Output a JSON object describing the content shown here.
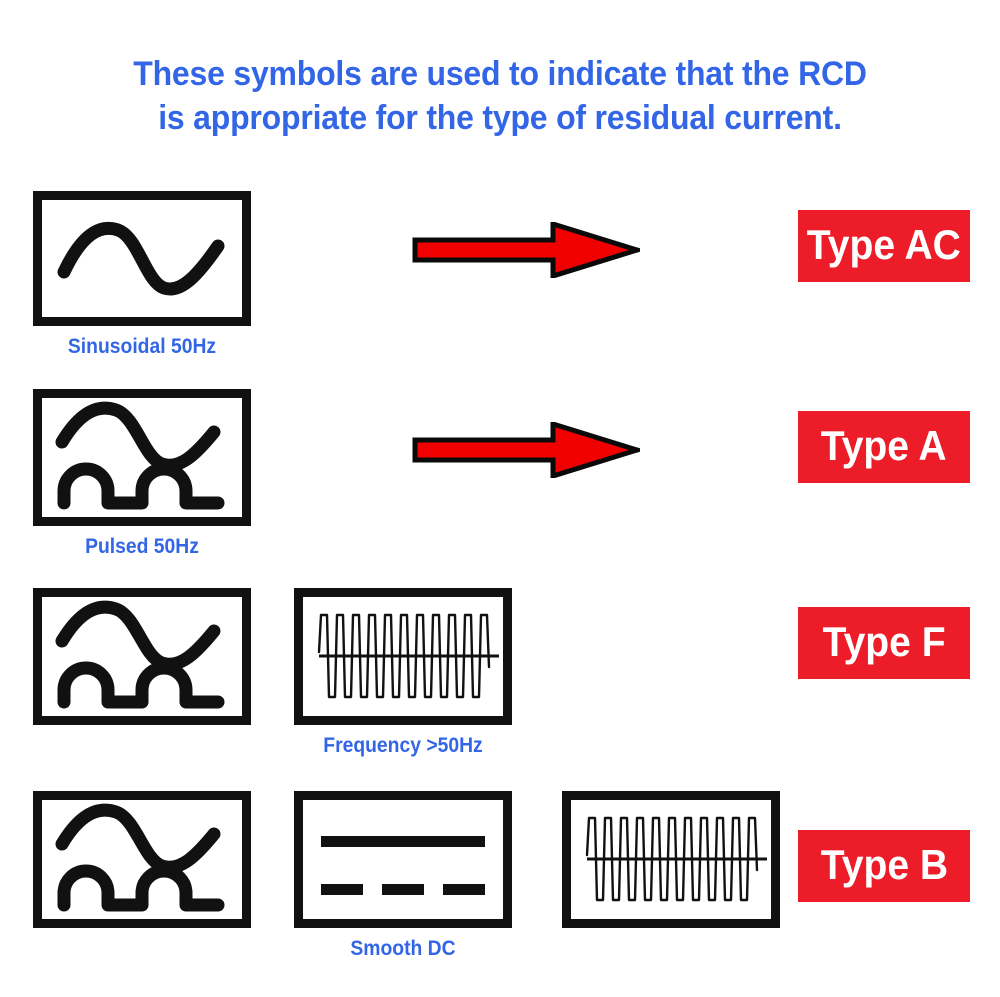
{
  "title": {
    "line1": "These symbols are used to indicate that the RCD",
    "line2": "is appropriate for the type of residual current.",
    "color": "#3366e6"
  },
  "colors": {
    "title_blue": "#3366e6",
    "caption_blue": "#3366e6",
    "badge_red": "#ec1c28",
    "arrow_red": "#f00000",
    "outline_black": "#111111",
    "background": "#ffffff"
  },
  "rows": [
    {
      "id": "row-ac",
      "symbols": [
        {
          "kind": "sine",
          "caption": "Sinusoidal 50Hz"
        }
      ],
      "arrow": true,
      "badge": "Type AC"
    },
    {
      "id": "row-a",
      "symbols": [
        {
          "kind": "sine-pulsed",
          "caption": "Pulsed 50Hz"
        }
      ],
      "arrow": true,
      "badge": "Type A"
    },
    {
      "id": "row-f",
      "symbols": [
        {
          "kind": "sine-pulsed",
          "caption": ""
        },
        {
          "kind": "high-frequency",
          "caption": "Frequency  >50Hz"
        }
      ],
      "arrow": false,
      "badge": "Type F"
    },
    {
      "id": "row-b",
      "symbols": [
        {
          "kind": "sine-pulsed",
          "caption": ""
        },
        {
          "kind": "smooth-dc",
          "caption": "Smooth DC"
        },
        {
          "kind": "high-frequency",
          "caption": ""
        }
      ],
      "arrow": false,
      "badge": "Type B"
    }
  ],
  "captions": {
    "sinusoidal": "Sinusoidal 50Hz",
    "pulsed": "Pulsed 50Hz",
    "frequency": "Frequency  >50Hz",
    "smooth_dc": "Smooth DC"
  },
  "badges": {
    "ac": "Type AC",
    "a": "Type A",
    "f": "Type F",
    "b": "Type B"
  },
  "icons": {
    "arrow": "right-arrow-icon",
    "sine": "sine-wave-icon",
    "pulsed": "pulsed-wave-icon",
    "high_frequency": "high-frequency-wave-icon",
    "smooth_dc": "smooth-dc-icon"
  }
}
